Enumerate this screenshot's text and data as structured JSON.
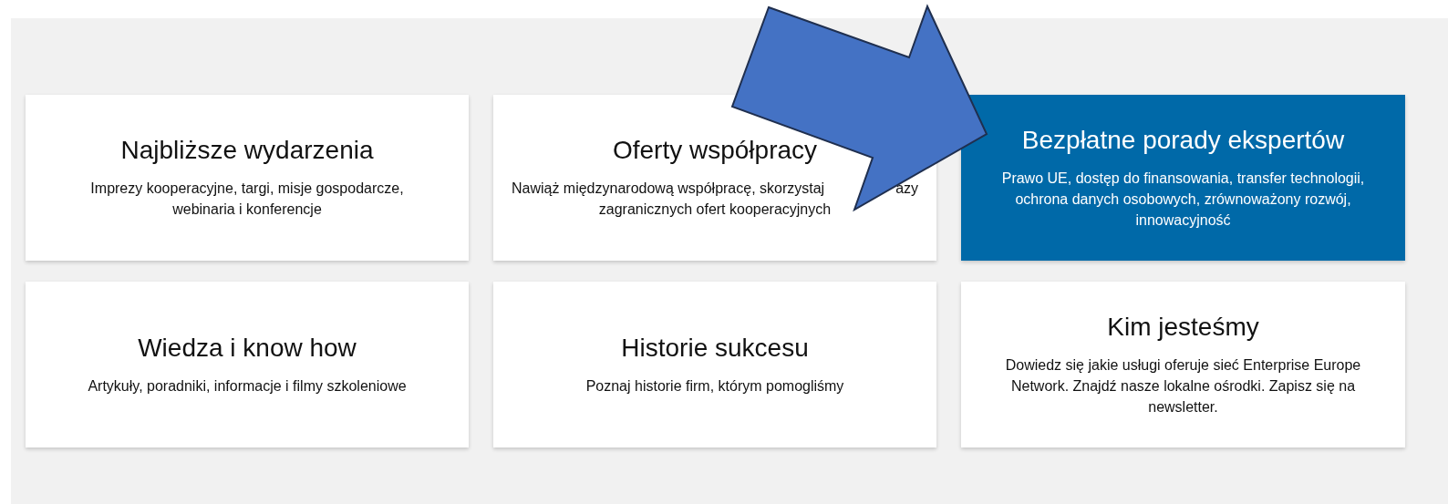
{
  "cards": [
    {
      "title": "Najbliższe wydarzenia",
      "description": "Imprezy kooperacyjne, targi, misje gospodarcze, webinaria i konferencje",
      "selected": false
    },
    {
      "title": "Oferty współpracy",
      "description_lines": [
        [
          "Nawiąż międzynarodową współpracę, skorzystaj",
          "azy"
        ],
        [
          "zagranicznych ofert kooperacyjnych"
        ]
      ],
      "selected": false
    },
    {
      "title": "Bezpłatne porady ekspertów",
      "description": "Prawo UE, dostęp do finansowania, transfer technologii, ochrona danych osobowych, zrównoważony rozwój, innowacyjność",
      "selected": true
    },
    {
      "title": "Wiedza i know how",
      "description": "Artykuły, poradniki, informacje i filmy szkoleniowe",
      "selected": false
    },
    {
      "title": "Historie sukcesu",
      "description": "Poznaj historie firm, którym pomogliśmy",
      "selected": false
    },
    {
      "title": "Kim jesteśmy",
      "description": "Dowiedz się jakie usługi oferuje sieć Enterprise Europe Network. Znajdź nasze lokalne ośrodki. Zapisz się na newsletter.",
      "selected": false
    }
  ]
}
